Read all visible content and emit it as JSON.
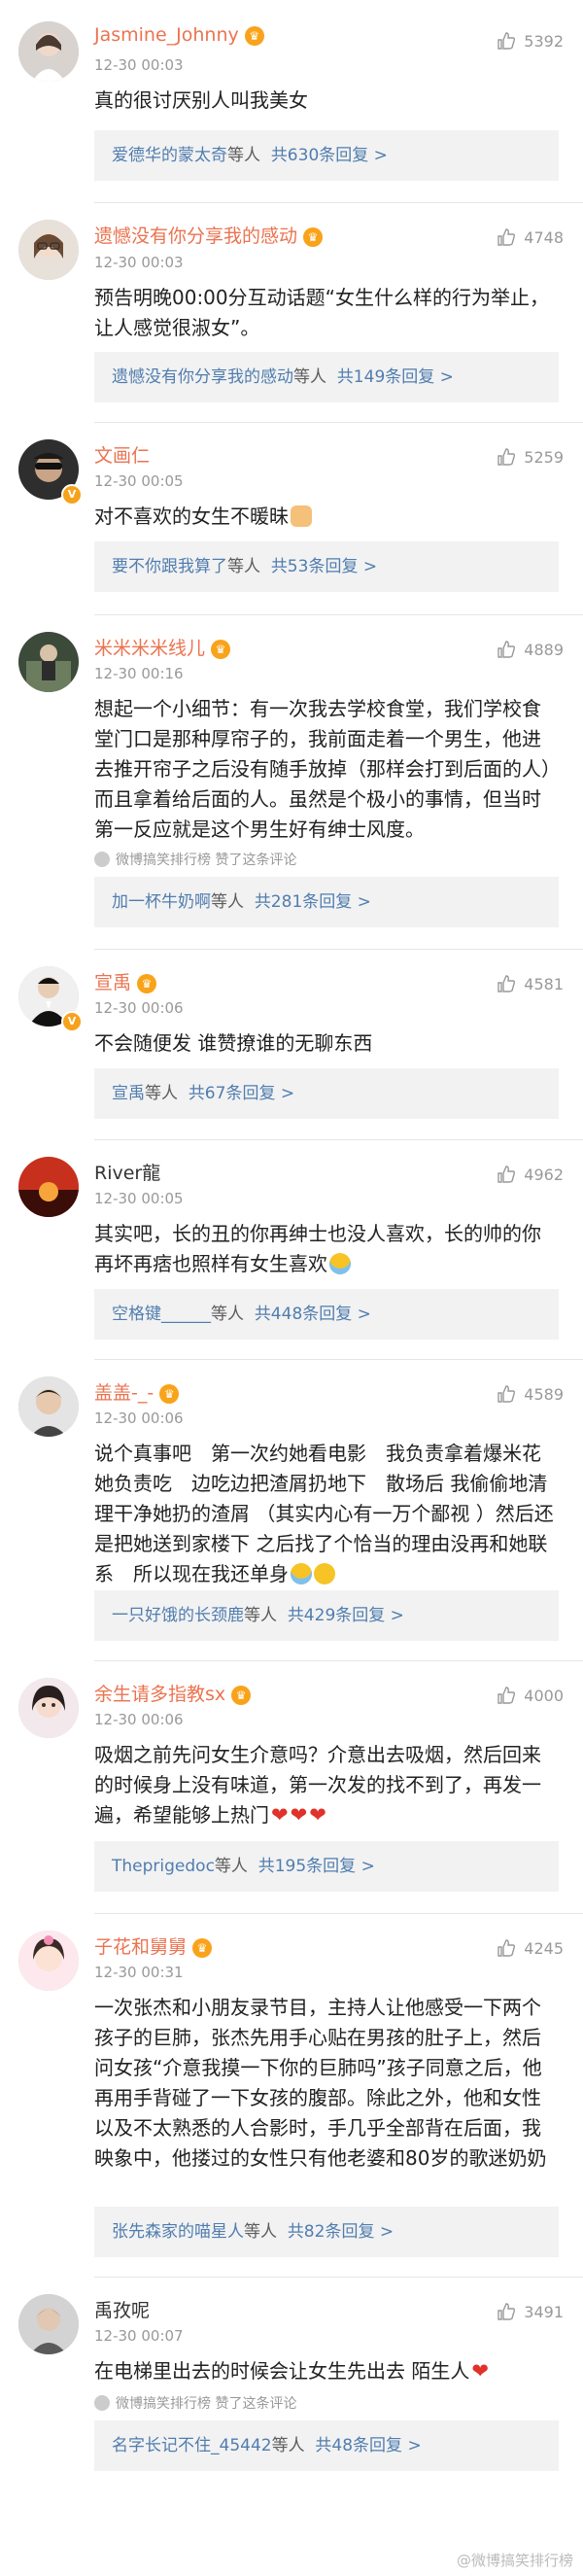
{
  "comments": [
    {
      "username": "Jasmine_Johnny",
      "time": "12-30 00:03",
      "likes": "5392",
      "text": "真的很讨厌别人叫我美女",
      "reply_user": "爱德华的蒙太奇",
      "reply_mid": "等人",
      "reply_count": "共630条回复",
      "reply_arrow": ">"
    },
    {
      "username": "遗憾没有你分享我的感动",
      "time": "12-30 00:03",
      "likes": "4748",
      "text": "预告明晚00:00分互动话题“女生什么样的行为举止，让人感觉很淑女”。",
      "reply_user": "遗憾没有你分享我的感动",
      "reply_mid": "等人",
      "reply_count": "共149条回复",
      "reply_arrow": ">"
    },
    {
      "username": "文画仁",
      "time": "12-30 00:05",
      "likes": "5259",
      "text": "对不喜欢的女生不暖昧",
      "reply_user": "要不你跟我算了",
      "reply_mid": "等人",
      "reply_count": "共53条回复",
      "reply_arrow": ">"
    },
    {
      "username": "米米米米线儿",
      "time": "12-30 00:16",
      "likes": "4889",
      "text": "想起一个小细节：有一次我去学校食堂，我们学校食堂门口是那种厚帘子的，我前面走着一个男生，他进去推开帘子之后没有随手放掉（那样会打到后面的人）而且拿着给后面的人。虽然是个极小的事情，但当时第一反应就是这个男生好有绅士风度。",
      "liked_by": "微博搞笑排行榜 赞了这条评论",
      "reply_user": "加一杯牛奶啊",
      "reply_mid": "等人",
      "reply_count": "共281条回复",
      "reply_arrow": ">"
    },
    {
      "username": "宣禹",
      "time": "12-30 00:06",
      "likes": "4581",
      "text": "不会随便发 谁赞撩谁的无聊东西",
      "reply_user": "宣禹",
      "reply_mid": "等人",
      "reply_count": "共67条回复",
      "reply_arrow": ">"
    },
    {
      "username": "River龍",
      "time": "12-30 00:05",
      "likes": "4962",
      "text": "其实吧，长的丑的你再绅士也没人喜欢，长的帅的你再坏再痞也照样有女生喜欢",
      "reply_user": "空格键______",
      "reply_mid": "等人",
      "reply_count": "共448条回复",
      "reply_arrow": ">"
    },
    {
      "username": "盖盖-_-",
      "time": "12-30 00:06",
      "likes": "4589",
      "text": "说个真事吧　第一次约她看电影　我负责拿着爆米花 她负责吃　边吃边把渣屑扔地下　散场后 我偷偷地清理干净她扔的渣屑 （其实内心有一万个鄙视 ）然后还是把她送到家楼下 之后找了个恰当的理由没再和她联系　所以现在我还单身",
      "reply_user": "一只好饿的长颈鹿",
      "reply_mid": "等人",
      "reply_count": "共429条回复",
      "reply_arrow": ">"
    },
    {
      "username": "余生请多指教sx",
      "time": "12-30 00:06",
      "likes": "4000",
      "text": "吸烟之前先问女生介意吗？介意出去吸烟，然后回来的时候身上没有味道，第一次发的找不到了，再发一遍，希望能够上热门",
      "reply_user": "Theprigedoc",
      "reply_mid": "等人",
      "reply_count": "共195条回复",
      "reply_arrow": ">"
    },
    {
      "username": "子花和舅舅",
      "time": "12-30 00:31",
      "likes": "4245",
      "text": "一次张杰和小朋友录节目，主持人让他感受一下两个孩子的巨肺，张杰先用手心贴在男孩的肚子上，然后问女孩“介意我摸一下你的巨肺吗”孩子同意之后，他再用手背碰了一下女孩的腹部。除此之外，他和女性以及不太熟悉的人合影时，手几乎全部背在后面，我映象中，他搂过的女性只有他老婆和80岁的歌迷奶奶",
      "reply_user": "张先森家的喵星人",
      "reply_mid": "等人",
      "reply_count": "共82条回复",
      "reply_arrow": ">"
    },
    {
      "username": "禹孜呢",
      "time": "12-30 00:07",
      "likes": "3491",
      "text": "在电梯里出去的时候会让女生先出去 陌生人",
      "liked_by": "微博搞笑排行榜 赞了这条评论",
      "reply_user": "名字长记不住_45442",
      "reply_mid": "等人",
      "reply_count": "共48条回复",
      "reply_arrow": ">"
    }
  ],
  "icons": {
    "like": "thumbs-up-icon",
    "level_badge": "level-badge-icon",
    "verified": "verified-v-icon"
  },
  "colors": {
    "username": "#eb7350",
    "reply_link": "#507daf",
    "reply_bg": "#f2f2f2",
    "muted": "#999999"
  },
  "watermark": "@微博搞笑排行榜"
}
